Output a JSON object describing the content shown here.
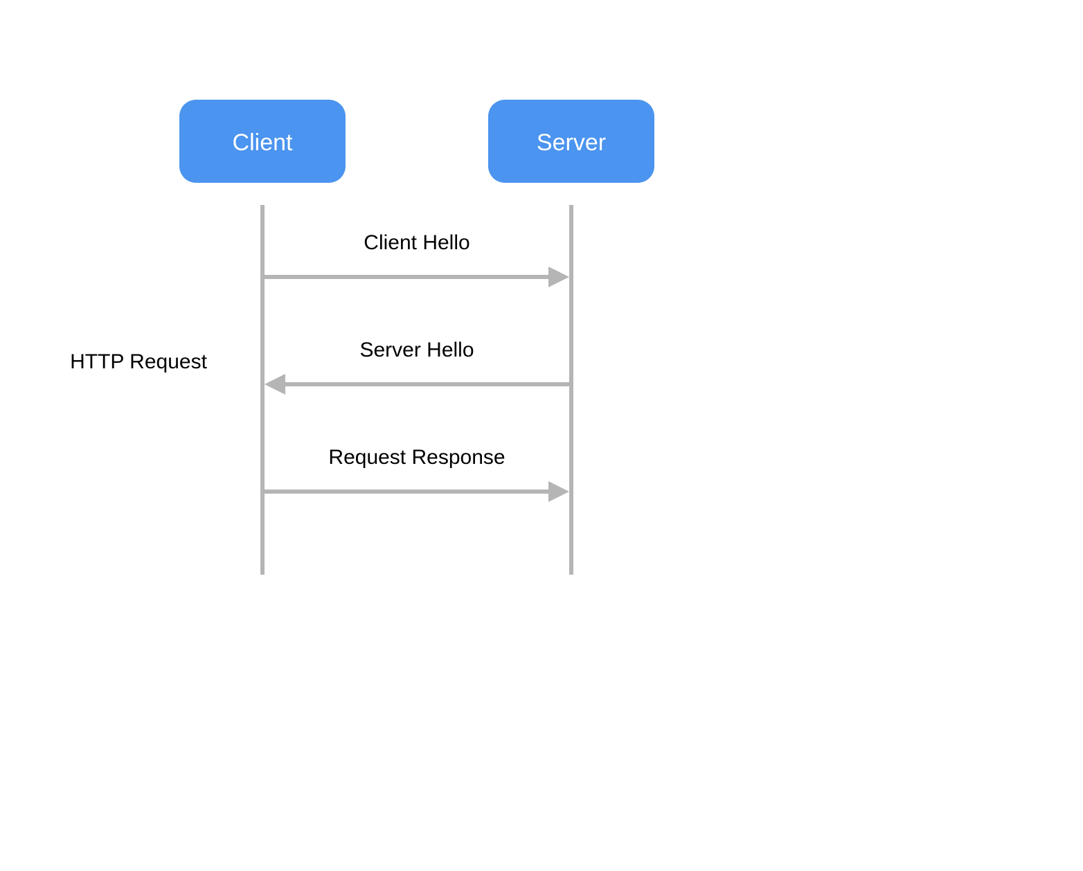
{
  "diagram": {
    "type": "sequence",
    "participants": {
      "client": {
        "label": "Client"
      },
      "server": {
        "label": "Server"
      }
    },
    "side_label": "HTTP Request",
    "messages": [
      {
        "from": "client",
        "to": "server",
        "label": "Client Hello"
      },
      {
        "from": "server",
        "to": "client",
        "label": "Server Hello"
      },
      {
        "from": "client",
        "to": "server",
        "label": "Request Response"
      }
    ],
    "colors": {
      "participant_fill": "#4b94ef",
      "participant_text": "#ffffff",
      "line": "#b5b5b5",
      "text": "#000000",
      "background": "#ffffff"
    }
  }
}
